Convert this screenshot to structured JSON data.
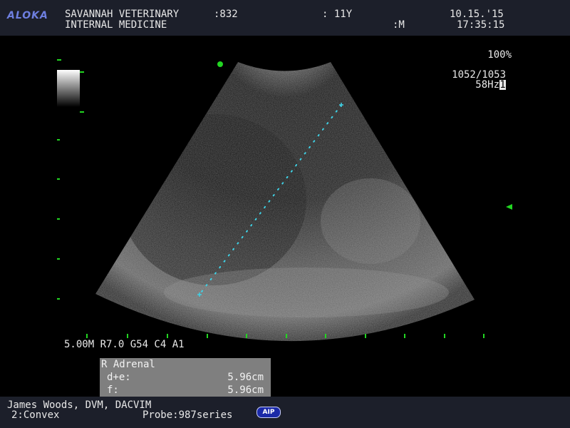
{
  "header": {
    "logo": "ALOKA",
    "line1": "SAVANNAH VETERINARY",
    "line2": "INTERNAL MEDICINE",
    "patient_id": ":832",
    "age": ": 11Y",
    "sex": ":M",
    "date": "10.15.'15",
    "time": "17:35:15"
  },
  "display": {
    "zoom": "100%",
    "frames": "1052/1053",
    "frame_rate": "58Hz",
    "frame_rate_marker": "1"
  },
  "scan_params": "5.00M R7.0 G54 C4 A1",
  "measurement": {
    "title": "R Adrenal",
    "rows": [
      {
        "label": "d+e:",
        "value": "5.96cm"
      },
      {
        "label": "f:",
        "value": "5.96cm"
      }
    ]
  },
  "footer": {
    "operator": "James Woods, DVM, DACVIM",
    "transducer": "2:Convex",
    "probe": "Probe:987series",
    "badge": "AIP"
  },
  "colors": {
    "header_bg": "#1c1f2a",
    "caliper": "#3fd2e6",
    "marker_green": "#22d622",
    "logo": "#6e7fe0"
  },
  "icons": {
    "focus_marker": "green-triangle-icon",
    "orientation_marker": "green-dot-icon"
  }
}
